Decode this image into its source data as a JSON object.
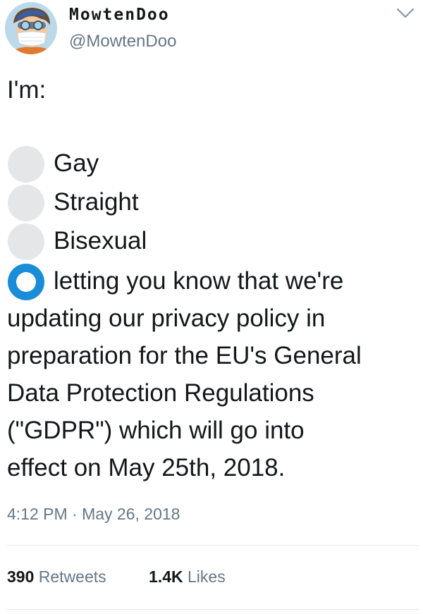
{
  "user": {
    "display_name": "MowtenDoo",
    "handle": "@MowtenDoo",
    "avatar_icon": "cartoon-avatar-with-mask"
  },
  "tweet": {
    "text": "I'm:",
    "poll_options": [
      {
        "label": "Gay",
        "selected": false
      },
      {
        "label": "Straight",
        "selected": false
      },
      {
        "label": "Bisexual",
        "selected": false
      }
    ],
    "selected_option": {
      "lines": [
        "letting you know that we're",
        "updating our privacy policy in",
        "preparation for the EU's General",
        "Data Protection Regulations",
        "(\"GDPR\") which will go into",
        "effect on May 25th, 2018."
      ],
      "selected": true
    },
    "timestamp": "4:12 PM · May 26, 2018"
  },
  "stats": {
    "retweets_count": "390",
    "retweets_label": "Retweets",
    "likes_count": "1.4K",
    "likes_label": "Likes"
  },
  "colors": {
    "accent": "#1a8cd8",
    "secondary_text": "#657786",
    "unselected_radio": "#e4e6e8"
  },
  "icons": {
    "menu": "chevron-down-icon"
  }
}
